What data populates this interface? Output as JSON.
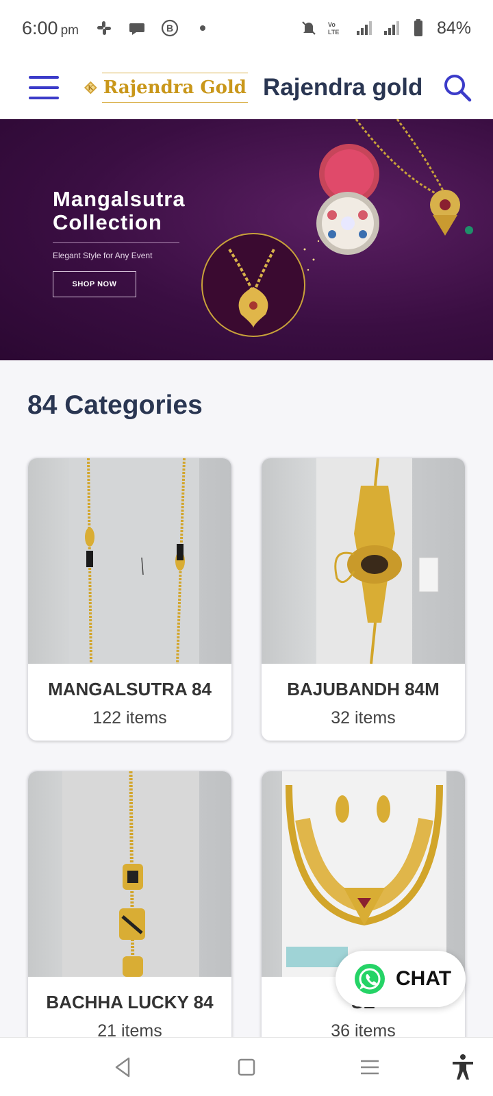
{
  "status_bar": {
    "time": "6:00",
    "ampm": "pm",
    "battery": "84%",
    "icons": [
      "slack-icon",
      "chat-bubble-icon",
      "b-badge-icon",
      "dot-icon",
      "mute-icon",
      "volte-icon",
      "signal-icon",
      "signal-icon",
      "battery-icon"
    ]
  },
  "app_bar": {
    "logo_text": "Rajendra Gold",
    "title": "Rajendra gold",
    "accent_color": "#3b3bc9"
  },
  "banner": {
    "title_line1": "Mangalsutra",
    "title_line2": "Collection",
    "subtitle": "Elegant Style for Any Event",
    "button_label": "SHOP NOW"
  },
  "categories": {
    "heading": "84 Categories",
    "items": [
      {
        "name": "MANGALSUTRA 84",
        "count": "122 items"
      },
      {
        "name": "BAJUBANDH 84M",
        "count": "32 items"
      },
      {
        "name": "BACHHA LUCKY 84",
        "count": "21 items"
      },
      {
        "name": "SE",
        "count": "36 items"
      }
    ]
  },
  "chat": {
    "label": "CHAT",
    "color": "#25d366"
  },
  "nav": {
    "icons": [
      "back-icon",
      "home-icon",
      "recents-icon",
      "accessibility-icon"
    ]
  }
}
